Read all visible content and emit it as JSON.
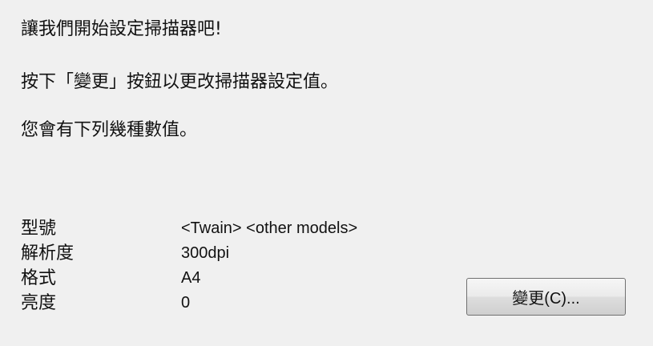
{
  "intro": {
    "line1": "讓我們開始設定掃描器吧!",
    "line2": "按下「變更」按鈕以更改掃描器設定值。",
    "line3": "您會有下列幾種數值。"
  },
  "settings": [
    {
      "label": "型號",
      "value": "<Twain> <other models>"
    },
    {
      "label": "解析度",
      "value": "300dpi"
    },
    {
      "label": "格式",
      "value": "A4"
    },
    {
      "label": "亮度",
      "value": "0"
    }
  ],
  "change_button": {
    "label": "變更(C)..."
  }
}
